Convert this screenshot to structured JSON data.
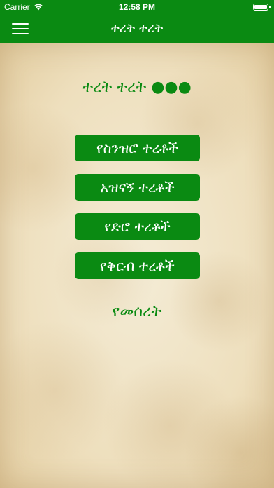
{
  "status_bar": {
    "carrier": "Carrier",
    "time": "12:58 PM",
    "icons": [
      "wifi-icon",
      "battery-icon"
    ]
  },
  "nav": {
    "title": "ተረት ተረት",
    "menu_icon": "hamburger-menu-icon"
  },
  "main": {
    "heading": "ተረት ተረት ●●●",
    "menu_items": [
      {
        "label": "የስንዝሮ ተረቶች"
      },
      {
        "label": "አዝናኝ ተረቶች"
      },
      {
        "label": "የድሮ ተረቶች"
      },
      {
        "label": "የቅርብ ተረቶች"
      }
    ],
    "footer_link": "የመሰረት"
  },
  "colors": {
    "accent": "#0a8a12",
    "text_on_accent": "#ffffff",
    "paper": "#f1e7cf"
  }
}
